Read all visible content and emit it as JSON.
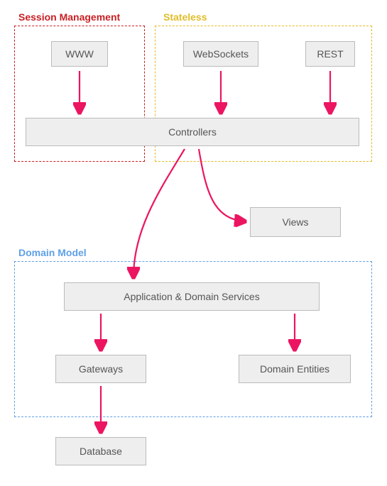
{
  "colors": {
    "arrow": "#ec1561",
    "session_border": "#c81f23",
    "session_label": "#c81f23",
    "stateless_border": "#e0bd28",
    "stateless_label": "#e0bd28",
    "domain_border": "#5fa0e8",
    "domain_label": "#5fa0e8",
    "node_fill": "#eeeeee",
    "node_border": "#bbbbbb"
  },
  "groups": {
    "session": {
      "label": "Session Management"
    },
    "stateless": {
      "label": "Stateless"
    },
    "domain": {
      "label": "Domain Model"
    }
  },
  "nodes": {
    "www": "WWW",
    "websockets": "WebSockets",
    "rest": "REST",
    "controllers": "Controllers",
    "views": "Views",
    "app_services": "Application & Domain Services",
    "gateways": "Gateways",
    "domain_entities": "Domain Entities",
    "database": "Database"
  }
}
